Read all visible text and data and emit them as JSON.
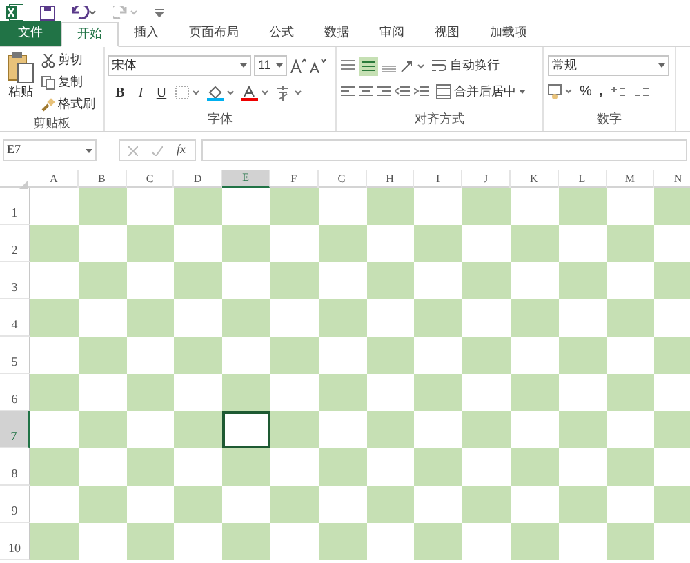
{
  "ribbon_tabs": [
    {
      "label": "文件",
      "kind": "file",
      "selected": false
    },
    {
      "label": "开始",
      "kind": "tab",
      "selected": true
    },
    {
      "label": "插入",
      "kind": "tab",
      "selected": false
    },
    {
      "label": "页面布局",
      "kind": "tab",
      "selected": false
    },
    {
      "label": "公式",
      "kind": "tab",
      "selected": false
    },
    {
      "label": "数据",
      "kind": "tab",
      "selected": false
    },
    {
      "label": "审阅",
      "kind": "tab",
      "selected": false
    },
    {
      "label": "视图",
      "kind": "tab",
      "selected": false
    },
    {
      "label": "加载项",
      "kind": "tab",
      "selected": false
    }
  ],
  "clipboard": {
    "label": "剪贴板",
    "paste": "粘贴",
    "cut": "剪切",
    "copy": "复制",
    "format_painter": "格式刷"
  },
  "font": {
    "label": "字体",
    "font_name": "宋体",
    "font_size": "11",
    "bold": "B",
    "italic": "I",
    "underline": "U"
  },
  "alignment": {
    "label": "对齐方式",
    "wrap_text": "自动换行",
    "merge_center": "合并后居中"
  },
  "number": {
    "label": "数字",
    "format": "常规",
    "percent": "%",
    "comma": ","
  },
  "formula_bar": {
    "name_box": "E7",
    "function_label": "fx"
  },
  "grid": {
    "columns": [
      {
        "label": "A",
        "selected": false
      },
      {
        "label": "B",
        "selected": false
      },
      {
        "label": "C",
        "selected": false
      },
      {
        "label": "D",
        "selected": false
      },
      {
        "label": "E",
        "selected": true
      },
      {
        "label": "F",
        "selected": false
      },
      {
        "label": "G",
        "selected": false
      },
      {
        "label": "H",
        "selected": false
      },
      {
        "label": "I",
        "selected": false
      },
      {
        "label": "J",
        "selected": false
      },
      {
        "label": "K",
        "selected": false
      },
      {
        "label": "L",
        "selected": false
      },
      {
        "label": "M",
        "selected": false
      },
      {
        "label": "N",
        "selected": false
      }
    ],
    "rows": [
      {
        "label": "1",
        "selected": false,
        "starts_shaded": false
      },
      {
        "label": "2",
        "selected": false,
        "starts_shaded": true
      },
      {
        "label": "3",
        "selected": false,
        "starts_shaded": false
      },
      {
        "label": "4",
        "selected": false,
        "starts_shaded": true
      },
      {
        "label": "5",
        "selected": false,
        "starts_shaded": false
      },
      {
        "label": "6",
        "selected": false,
        "starts_shaded": true
      },
      {
        "label": "7",
        "selected": true,
        "starts_shaded": false
      },
      {
        "label": "8",
        "selected": false,
        "starts_shaded": true
      },
      {
        "label": "9",
        "selected": false,
        "starts_shaded": false
      },
      {
        "label": "10",
        "selected": false,
        "starts_shaded": true
      }
    ]
  }
}
